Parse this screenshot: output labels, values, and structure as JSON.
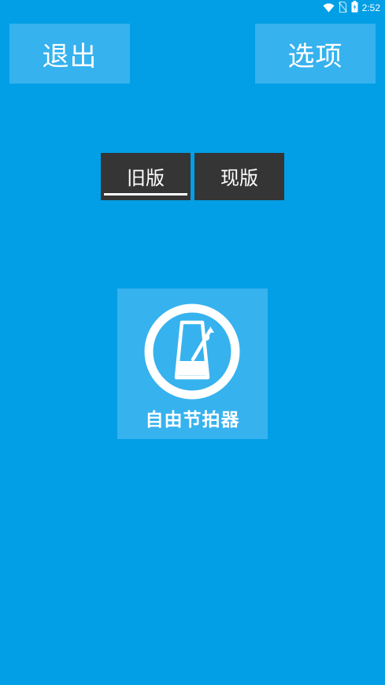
{
  "status_bar": {
    "time": "2:52",
    "icons": [
      "wifi-icon",
      "no-sim-icon",
      "battery-icon"
    ]
  },
  "header": {
    "exit_label": "退出",
    "options_label": "选项"
  },
  "version_tabs": {
    "items": [
      {
        "label": "旧版",
        "selected": true
      },
      {
        "label": "现版",
        "selected": false
      }
    ]
  },
  "main": {
    "tile_label": "自由节拍器",
    "tile_icon": "metronome-icon"
  },
  "colors": {
    "background": "#039fe6",
    "button": "#36b2ee",
    "tab": "#353535",
    "text": "#ffffff"
  }
}
